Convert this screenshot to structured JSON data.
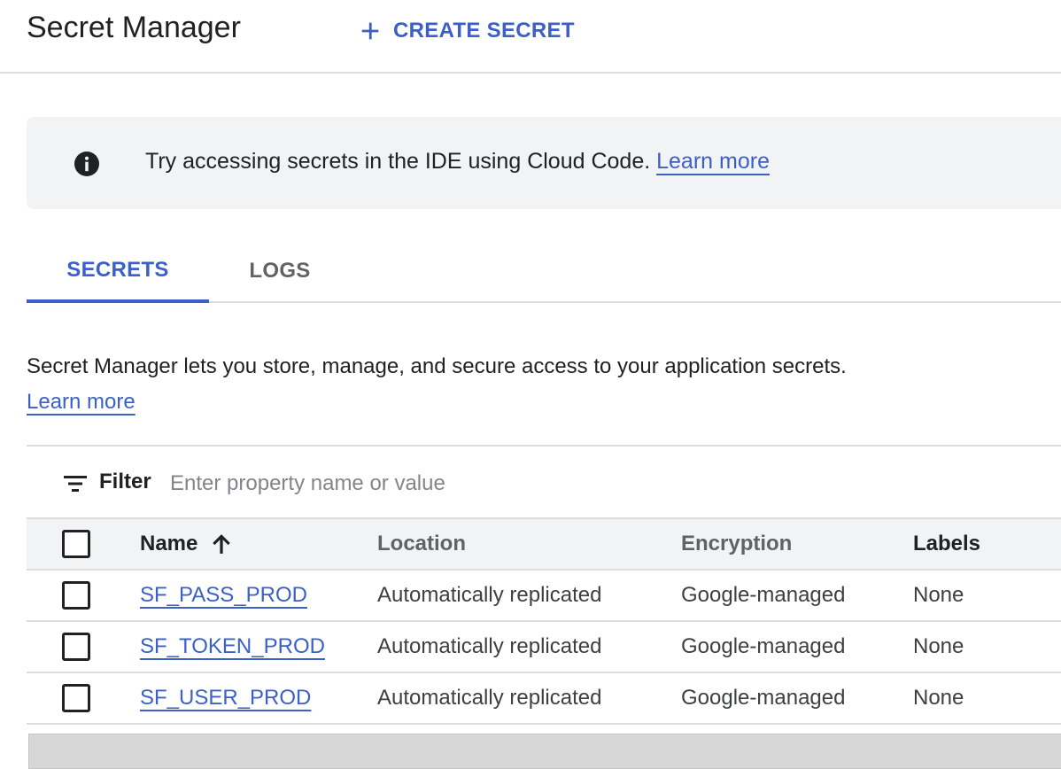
{
  "header": {
    "title": "Secret Manager",
    "create_label": "CREATE SECRET"
  },
  "banner": {
    "text": "Try accessing secrets in the IDE using Cloud Code.",
    "link": "Learn more"
  },
  "tabs": [
    {
      "label": "SECRETS",
      "active": true
    },
    {
      "label": "LOGS",
      "active": false
    }
  ],
  "description": {
    "text": "Secret Manager lets you store, manage, and secure access to your application secrets.",
    "link": "Learn more"
  },
  "filter": {
    "label": "Filter",
    "placeholder": "Enter property name or value"
  },
  "table": {
    "columns": [
      "Name",
      "Location",
      "Encryption",
      "Labels"
    ],
    "rows": [
      {
        "name": "SF_PASS_PROD",
        "location": "Automatically replicated",
        "encryption": "Google-managed",
        "labels": "None"
      },
      {
        "name": "SF_TOKEN_PROD",
        "location": "Automatically replicated",
        "encryption": "Google-managed",
        "labels": "None"
      },
      {
        "name": "SF_USER_PROD",
        "location": "Automatically replicated",
        "encryption": "Google-managed",
        "labels": "None"
      }
    ]
  },
  "colors": {
    "accent": "#3c5fc9",
    "banner_bg": "#f1f3f4",
    "divider": "#dadce0"
  },
  "icons": {
    "create": "plus-icon",
    "info": "info-icon",
    "filter": "filter-icon",
    "sort": "arrow-up-icon"
  }
}
